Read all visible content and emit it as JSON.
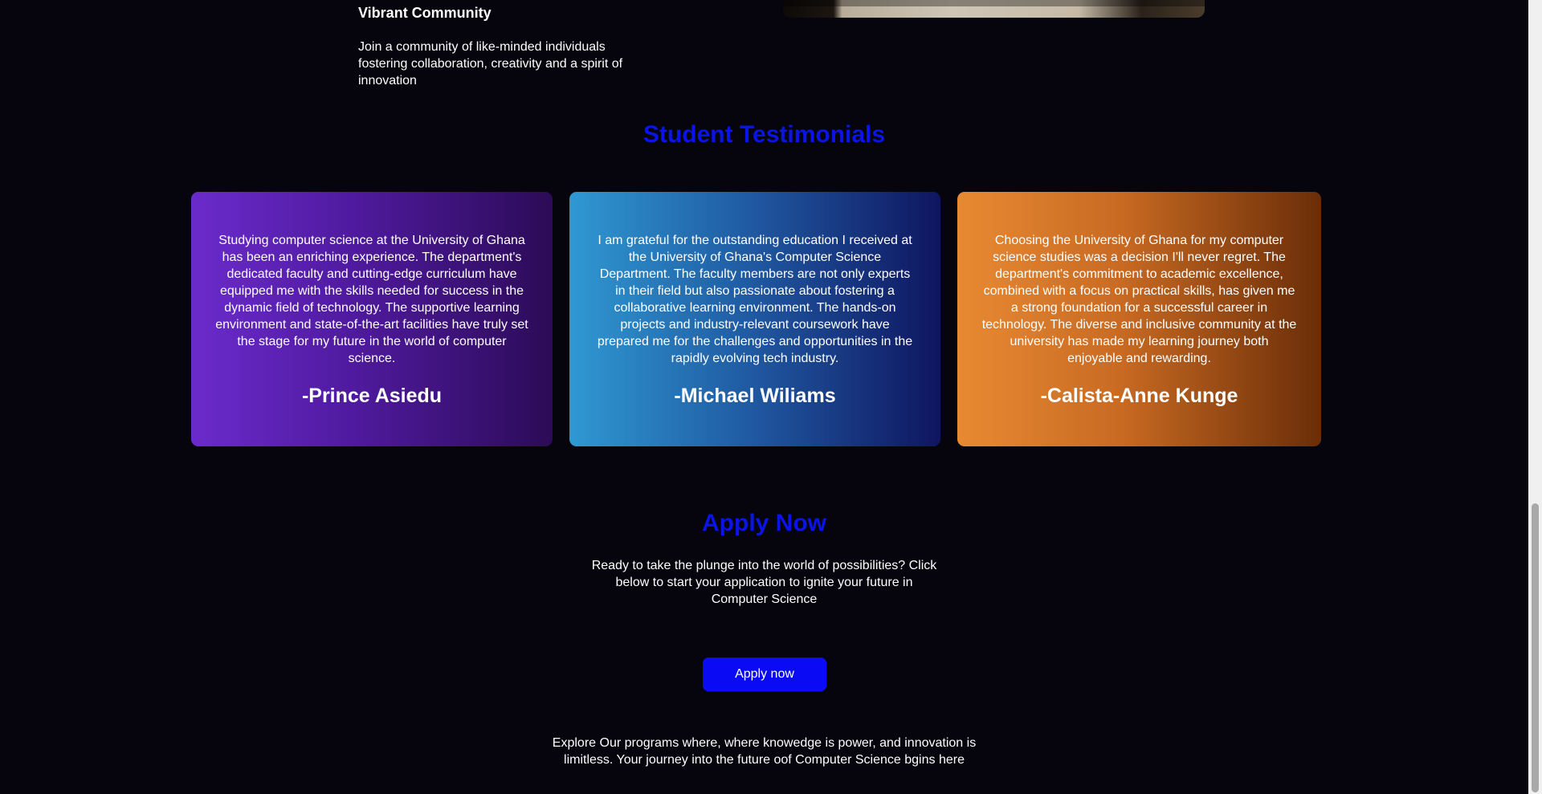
{
  "feature": {
    "title": "Vibrant Community",
    "text": "Join a community of like-minded individuals fostering collaboration, creativity and a spirit of innovation"
  },
  "testimonials": {
    "heading": "Student Testimonials",
    "items": [
      {
        "quote": "Studying computer science at the University of Ghana has been an enriching experience. The department's dedicated faculty and cutting-edge curriculum have equipped me with the skills needed for success in the dynamic field of technology. The supportive learning environment and state-of-the-art facilities have truly set the stage for my future in the world of computer science.",
        "author": "-Prince Asiedu"
      },
      {
        "quote": "I am grateful for the outstanding education I received at the University of Ghana's Computer Science Department. The faculty members are not only experts in their field but also passionate about fostering a collaborative learning environment. The hands-on projects and industry-relevant coursework have prepared me for the challenges and opportunities in the rapidly evolving tech industry.",
        "author": "-Michael Wiliams"
      },
      {
        "quote": "Choosing the University of Ghana for my computer science studies was a decision I'll never regret. The department's commitment to academic excellence, combined with a focus on practical skills, has given me a strong foundation for a successful career in technology. The diverse and inclusive community at the university has made my learning journey both enjoyable and rewarding.",
        "author": "-Calista-Anne Kunge"
      }
    ]
  },
  "apply": {
    "heading": "Apply Now",
    "text": "Ready to take the plunge into the world of possibilities? Click below to start your application to ignite your future in Computer Science",
    "button_label": "Apply now"
  },
  "footer": {
    "line1": "Explore Our programs where, where knowedge is power, and innovation is",
    "line2": "limitless. Your journey into the future oof Computer Science bgins here"
  },
  "scroll": {
    "position": 0.64
  }
}
